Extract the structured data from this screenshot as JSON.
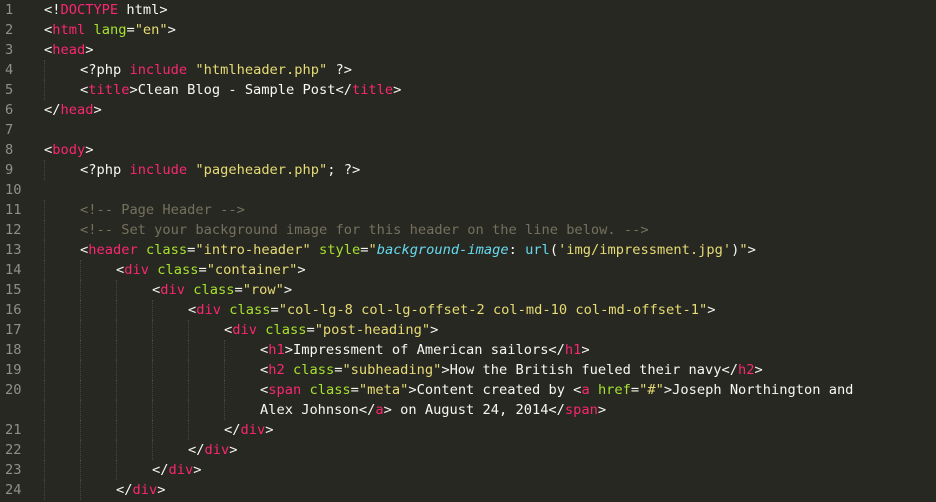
{
  "editor": {
    "theme": {
      "background": "#272822",
      "gutter_text": "#8f908a",
      "tag": "#f92672",
      "attribute": "#a6e22e",
      "string": "#e6db74",
      "comment": "#75715e",
      "property": "#66d9ef",
      "plain": "#f8f8f2"
    },
    "lines": [
      {
        "num": "1",
        "indent": 0,
        "tokens": [
          [
            "p",
            "<!"
          ],
          [
            "tag",
            "DOCTYPE"
          ],
          [
            "p",
            " html>"
          ]
        ]
      },
      {
        "num": "2",
        "indent": 0,
        "tokens": [
          [
            "p",
            "<"
          ],
          [
            "tag",
            "html"
          ],
          [
            "p",
            " "
          ],
          [
            "attr",
            "lang"
          ],
          [
            "p",
            "="
          ],
          [
            "str",
            "\"en\""
          ],
          [
            "p",
            ">"
          ]
        ]
      },
      {
        "num": "3",
        "indent": 0,
        "tokens": [
          [
            "p",
            "<"
          ],
          [
            "tag",
            "head"
          ],
          [
            "p",
            ">"
          ]
        ]
      },
      {
        "num": "4",
        "indent": 1,
        "tokens": [
          [
            "p",
            "<?php "
          ],
          [
            "kw",
            "include"
          ],
          [
            "p",
            " "
          ],
          [
            "str",
            "\"htmlheader.php\""
          ],
          [
            "p",
            " ?>"
          ]
        ]
      },
      {
        "num": "5",
        "indent": 1,
        "tokens": [
          [
            "p",
            "<"
          ],
          [
            "tag",
            "title"
          ],
          [
            "p",
            ">Clean Blog - Sample Post</"
          ],
          [
            "tag",
            "title"
          ],
          [
            "p",
            ">"
          ]
        ]
      },
      {
        "num": "6",
        "indent": 0,
        "tokens": [
          [
            "p",
            "</"
          ],
          [
            "tag",
            "head"
          ],
          [
            "p",
            ">"
          ]
        ]
      },
      {
        "num": "7",
        "indent": 0,
        "tokens": []
      },
      {
        "num": "8",
        "indent": 0,
        "tokens": [
          [
            "p",
            "<"
          ],
          [
            "tag",
            "body"
          ],
          [
            "p",
            ">"
          ]
        ]
      },
      {
        "num": "9",
        "indent": 1,
        "tokens": [
          [
            "p",
            "<?php "
          ],
          [
            "kw",
            "include"
          ],
          [
            "p",
            " "
          ],
          [
            "str",
            "\"pageheader.php\""
          ],
          [
            "p",
            "; ?>"
          ]
        ]
      },
      {
        "num": "10",
        "indent": 0,
        "tokens": []
      },
      {
        "num": "11",
        "indent": 1,
        "tokens": [
          [
            "com",
            "<!-- Page Header -->"
          ]
        ]
      },
      {
        "num": "12",
        "indent": 1,
        "tokens": [
          [
            "com",
            "<!-- Set your background image for this header on the line below. -->"
          ]
        ]
      },
      {
        "num": "13",
        "indent": 1,
        "tokens": [
          [
            "p",
            "<"
          ],
          [
            "tag",
            "header"
          ],
          [
            "p",
            " "
          ],
          [
            "attr",
            "class"
          ],
          [
            "p",
            "="
          ],
          [
            "str",
            "\"intro-header\""
          ],
          [
            "p",
            " "
          ],
          [
            "attr",
            "style"
          ],
          [
            "p",
            "="
          ],
          [
            "str",
            "\""
          ],
          [
            "prop",
            "background-image"
          ],
          [
            "p",
            ": "
          ],
          [
            "fn",
            "url"
          ],
          [
            "p",
            "("
          ],
          [
            "str",
            "'img/impressment.jpg'"
          ],
          [
            "p",
            ")"
          ],
          [
            "str",
            "\""
          ],
          [
            "p",
            ">"
          ]
        ]
      },
      {
        "num": "14",
        "indent": 2,
        "tokens": [
          [
            "p",
            "<"
          ],
          [
            "tag",
            "div"
          ],
          [
            "p",
            " "
          ],
          [
            "attr",
            "class"
          ],
          [
            "p",
            "="
          ],
          [
            "str",
            "\"container\""
          ],
          [
            "p",
            ">"
          ]
        ]
      },
      {
        "num": "15",
        "indent": 3,
        "tokens": [
          [
            "p",
            "<"
          ],
          [
            "tag",
            "div"
          ],
          [
            "p",
            " "
          ],
          [
            "attr",
            "class"
          ],
          [
            "p",
            "="
          ],
          [
            "str",
            "\"row\""
          ],
          [
            "p",
            ">"
          ]
        ]
      },
      {
        "num": "16",
        "indent": 4,
        "tokens": [
          [
            "p",
            "<"
          ],
          [
            "tag",
            "div"
          ],
          [
            "p",
            " "
          ],
          [
            "attr",
            "class"
          ],
          [
            "p",
            "="
          ],
          [
            "str",
            "\"col-lg-8 col-lg-offset-2 col-md-10 col-md-offset-1\""
          ],
          [
            "p",
            ">"
          ]
        ]
      },
      {
        "num": "17",
        "indent": 5,
        "tokens": [
          [
            "p",
            "<"
          ],
          [
            "tag",
            "div"
          ],
          [
            "p",
            " "
          ],
          [
            "attr",
            "class"
          ],
          [
            "p",
            "="
          ],
          [
            "str",
            "\"post-heading\""
          ],
          [
            "p",
            ">"
          ]
        ]
      },
      {
        "num": "18",
        "indent": 6,
        "tokens": [
          [
            "p",
            "<"
          ],
          [
            "tag",
            "h1"
          ],
          [
            "p",
            ">Impressment of American sailors</"
          ],
          [
            "tag",
            "h1"
          ],
          [
            "p",
            ">"
          ]
        ]
      },
      {
        "num": "19",
        "indent": 6,
        "tokens": [
          [
            "p",
            "<"
          ],
          [
            "tag",
            "h2"
          ],
          [
            "p",
            " "
          ],
          [
            "attr",
            "class"
          ],
          [
            "p",
            "="
          ],
          [
            "str",
            "\"subheading\""
          ],
          [
            "p",
            ">How the British fueled their navy</"
          ],
          [
            "tag",
            "h2"
          ],
          [
            "p",
            ">"
          ]
        ]
      },
      {
        "num": "20",
        "indent": 6,
        "tokens": [
          [
            "p",
            "<"
          ],
          [
            "tag",
            "span"
          ],
          [
            "p",
            " "
          ],
          [
            "attr",
            "class"
          ],
          [
            "p",
            "="
          ],
          [
            "str",
            "\"meta\""
          ],
          [
            "p",
            ">Content created by <"
          ],
          [
            "tag",
            "a"
          ],
          [
            "p",
            " "
          ],
          [
            "attr",
            "href"
          ],
          [
            "p",
            "="
          ],
          [
            "str",
            "\"#\""
          ],
          [
            "p",
            ">Joseph Northington and"
          ]
        ]
      },
      {
        "num": "",
        "indent": 6,
        "tokens": [
          [
            "p",
            "Alex Johnson</"
          ],
          [
            "tag",
            "a"
          ],
          [
            "p",
            "> on August 24, 2014</"
          ],
          [
            "tag",
            "span"
          ],
          [
            "p",
            ">"
          ]
        ]
      },
      {
        "num": "21",
        "indent": 5,
        "tokens": [
          [
            "p",
            "</"
          ],
          [
            "tag",
            "div"
          ],
          [
            "p",
            ">"
          ]
        ]
      },
      {
        "num": "22",
        "indent": 4,
        "tokens": [
          [
            "p",
            "</"
          ],
          [
            "tag",
            "div"
          ],
          [
            "p",
            ">"
          ]
        ]
      },
      {
        "num": "23",
        "indent": 3,
        "tokens": [
          [
            "p",
            "</"
          ],
          [
            "tag",
            "div"
          ],
          [
            "p",
            ">"
          ]
        ]
      },
      {
        "num": "24",
        "indent": 2,
        "tokens": [
          [
            "p",
            "</"
          ],
          [
            "tag",
            "div"
          ],
          [
            "p",
            ">"
          ]
        ]
      }
    ]
  }
}
